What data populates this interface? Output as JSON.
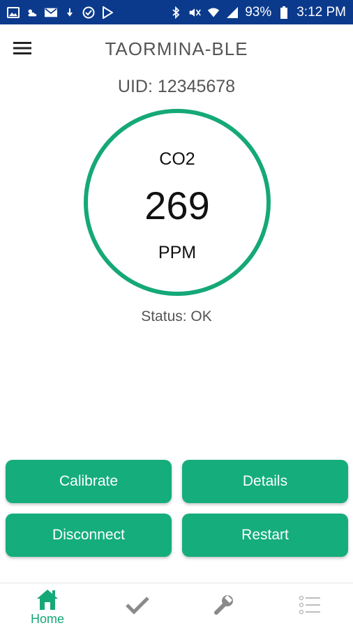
{
  "status_bar": {
    "battery": "93%",
    "time": "3:12 PM",
    "left_icons": [
      "image-icon",
      "weather-icon",
      "mail-icon",
      "download-icon",
      "check-circle-icon",
      "play-store-icon"
    ],
    "right_icons": [
      "bluetooth-icon",
      "mute-icon",
      "wifi-icon",
      "signal-icon",
      "battery-icon"
    ]
  },
  "app_bar": {
    "title": "TAORMINA-BLE",
    "menu_icon": "hamburger-menu-icon"
  },
  "device": {
    "uid": "UID: 12345678"
  },
  "gauge": {
    "label": "CO2",
    "value": "269",
    "unit": "PPM",
    "ring_color": "#15a878"
  },
  "status": {
    "text": "Status: OK"
  },
  "actions": {
    "calibrate": "Calibrate",
    "details": "Details",
    "disconnect": "Disconnect",
    "restart": "Restart",
    "button_color": "#15ad7c"
  },
  "bottom_nav": {
    "home_label": "Home",
    "active_color": "#15a878",
    "inactive_color": "#8a8a8a",
    "items": [
      "home-icon",
      "check-icon",
      "wrench-icon",
      "list-icon"
    ]
  },
  "colors": {
    "status_bar": "#0b3a8c"
  }
}
